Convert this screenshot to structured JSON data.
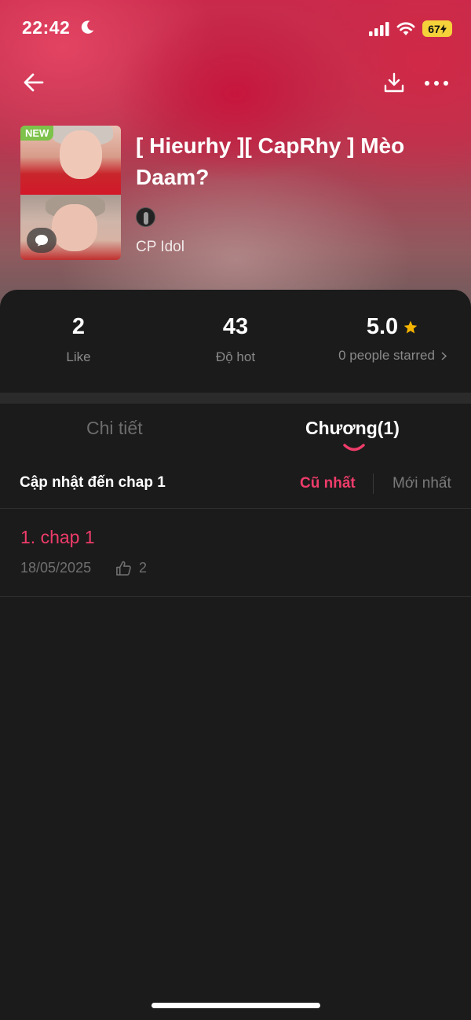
{
  "status_bar": {
    "time": "22:42",
    "battery": "67",
    "icons": [
      "moon-icon",
      "signal-icon",
      "wifi-icon",
      "battery-charging-icon"
    ]
  },
  "nav": {
    "icons": [
      "back-arrow-icon",
      "download-icon",
      "more-icon"
    ]
  },
  "story": {
    "cover_badge": "NEW",
    "title": "[ Hieurhy ][ CapRhy ] Mèo Daam?",
    "genre": "CP Idol"
  },
  "stats": {
    "likes": {
      "value": "2",
      "label": "Like"
    },
    "hot": {
      "value": "43",
      "label": "Độ hot"
    },
    "rating": {
      "value": "5.0",
      "label": "0 people starred"
    }
  },
  "tabs": [
    {
      "label": "Chi tiết",
      "active": false
    },
    {
      "label": "Chương(1)",
      "active": true
    }
  ],
  "chapter_list": {
    "update_label": "Cập nhật đến chap 1",
    "sort_oldest": "Cũ nhất",
    "sort_newest": "Mới nhất",
    "items": [
      {
        "title": "1. chap 1",
        "date": "18/05/2025",
        "likes": "2"
      }
    ]
  },
  "colors": {
    "accent": "#ee3c6a",
    "background": "#1b1b1b",
    "star": "#f5b400",
    "new_badge": "#7dc24a"
  }
}
